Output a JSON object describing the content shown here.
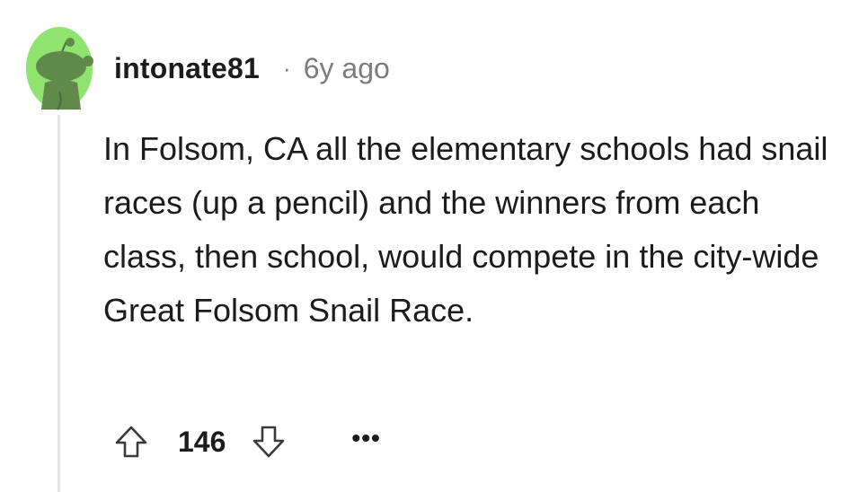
{
  "comment": {
    "username": "intonate81",
    "separator": "·",
    "timestamp": "6y ago",
    "body": "In Folsom, CA all the elementary schools had snail races (up a pencil) and the winners from each class, then school, would compete in the city-wide Great Folsom Snail Race.",
    "score": "146",
    "more_label": "•••",
    "avatar_icon": "snoo-avatar-icon",
    "upvote_icon": "upvote-arrow-icon",
    "downvote_icon": "downvote-arrow-icon",
    "avatar_color": "#8fe36e"
  }
}
